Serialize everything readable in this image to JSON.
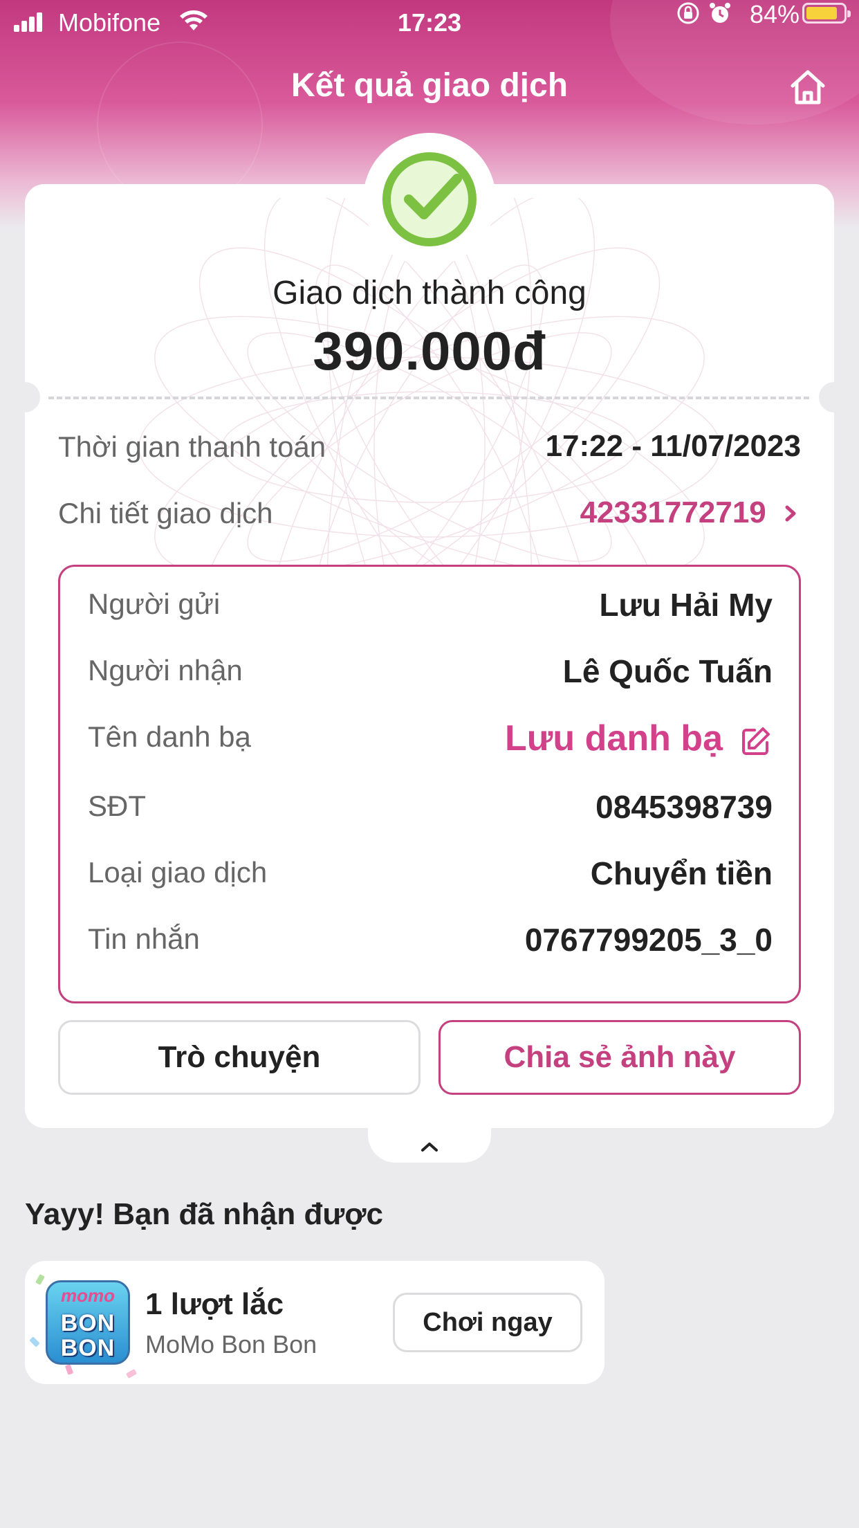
{
  "status_bar": {
    "carrier": "Mobifone",
    "time": "17:23",
    "battery": "84%"
  },
  "header": {
    "title": "Kết quả giao dịch"
  },
  "transaction": {
    "status": "Giao dịch thành công",
    "amount": "390.000đ",
    "pay_time_label": "Thời gian thanh toán",
    "pay_time_value": "17:22 - 11/07/2023",
    "detail_label": "Chi tiết giao dịch",
    "detail_value": "42331772719"
  },
  "details": {
    "sender_label": "Người gửi",
    "sender_value": "Lưu Hải My",
    "receiver_label": "Người nhận",
    "receiver_value": "Lê Quốc Tuấn",
    "contact_label": "Tên danh bạ",
    "contact_value": "Lưu danh bạ",
    "phone_label": "SĐT",
    "phone_value": "0845398739",
    "type_label": "Loại giao dịch",
    "type_value": "Chuyển tiền",
    "message_label": "Tin nhắn",
    "message_value": "0767799205_3_0"
  },
  "actions": {
    "chat": "Trò chuyện",
    "share": "Chia sẻ ảnh này"
  },
  "reward": {
    "title": "Yayy! Bạn đã nhận được",
    "count": "1 lượt lắc",
    "source": "MoMo Bon Bon",
    "play": "Chơi ngay",
    "icon_top": "momo",
    "icon_bottom_1": "BON",
    "icon_bottom_2": "BON"
  },
  "colors": {
    "brand": "#c4407f",
    "success": "#7dc142",
    "background": "#ebebee"
  },
  "icons": [
    "signal-icon",
    "wifi-icon",
    "rotation-lock-icon",
    "alarm-icon",
    "battery-icon",
    "home-icon",
    "success-check-icon",
    "chevron-right-icon",
    "edit-icon",
    "chevron-up-icon",
    "momo-bonbon-icon"
  ]
}
